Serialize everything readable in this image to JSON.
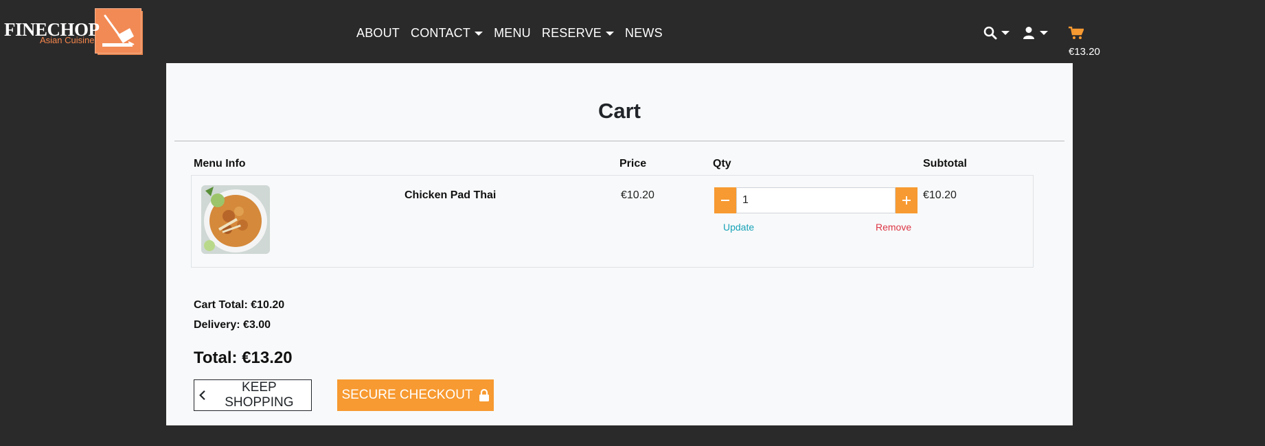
{
  "brand": {
    "name": "FINECHOP",
    "tagline": "Asian Cuisine"
  },
  "nav": {
    "links": [
      {
        "label": "ABOUT",
        "dropdown": false
      },
      {
        "label": "CONTACT",
        "dropdown": true
      },
      {
        "label": "MENU",
        "dropdown": false
      },
      {
        "label": "RESERVE",
        "dropdown": true
      },
      {
        "label": "NEWS",
        "dropdown": false
      }
    ],
    "icons": [
      "search-icon",
      "user-icon",
      "cart-icon"
    ],
    "cart_amount": "€13.20"
  },
  "cart": {
    "title": "Cart",
    "headers": {
      "menu_info": "Menu Info",
      "price": "Price",
      "qty": "Qty",
      "subtotal": "Subtotal"
    },
    "items": [
      {
        "name": "Chicken Pad Thai",
        "price": "€10.20",
        "qty": "1",
        "subtotal": "€10.20",
        "update_label": "Update",
        "remove_label": "Remove"
      }
    ],
    "cart_total": "Cart Total: €10.20",
    "delivery": "Delivery: €3.00",
    "total": "Total: €13.20",
    "keep_shopping_label": "KEEP SHOPPING",
    "checkout_label": "SECURE CHECKOUT"
  },
  "colors": {
    "background": "#2b2a2b",
    "accent": "#f79a31",
    "brand": "#f28a55",
    "update_link": "#17a2b8",
    "remove_link": "#dc3545"
  }
}
